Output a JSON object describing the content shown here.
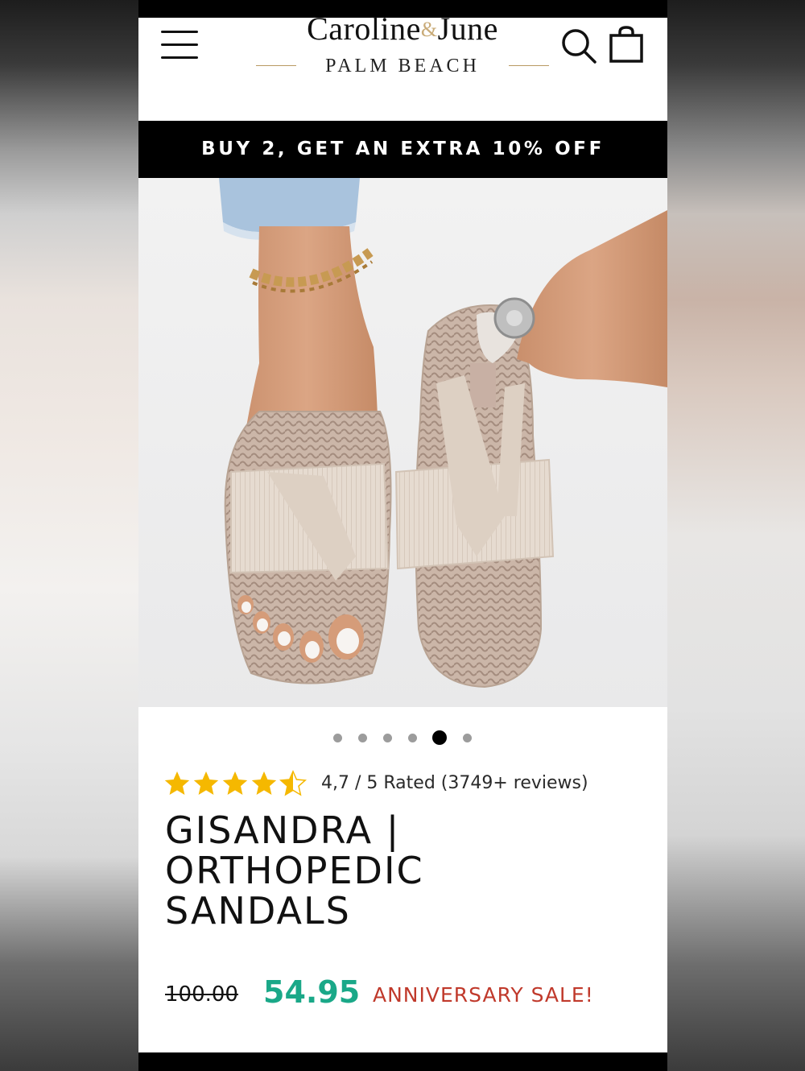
{
  "brand": {
    "name_part1": "Caroline",
    "ampersand": "&",
    "name_part2": "June",
    "location": "PALM BEACH"
  },
  "promo_banner": {
    "text": "BUY 2, GET AN EXTRA 10% OFF"
  },
  "carousel": {
    "slide_count": 6,
    "active_index": 4
  },
  "rating": {
    "value": 4.7,
    "stars_filled": 4.5,
    "text": "4,7 / 5 Rated (3749+ reviews)"
  },
  "product": {
    "title": "GISANDRA | ORTHOPEDIC SANDALS"
  },
  "price": {
    "original": "100.00",
    "sale": "54.95",
    "sale_label": "ANNIVERSARY SALE!"
  },
  "colors": {
    "sale_price": "#1aa888",
    "sale_label": "#c0392b",
    "star": "#f5b800",
    "brand_accent": "#c9ab78"
  },
  "icons": [
    "menu-icon",
    "search-icon",
    "shopping-bag-icon",
    "star-icon"
  ]
}
